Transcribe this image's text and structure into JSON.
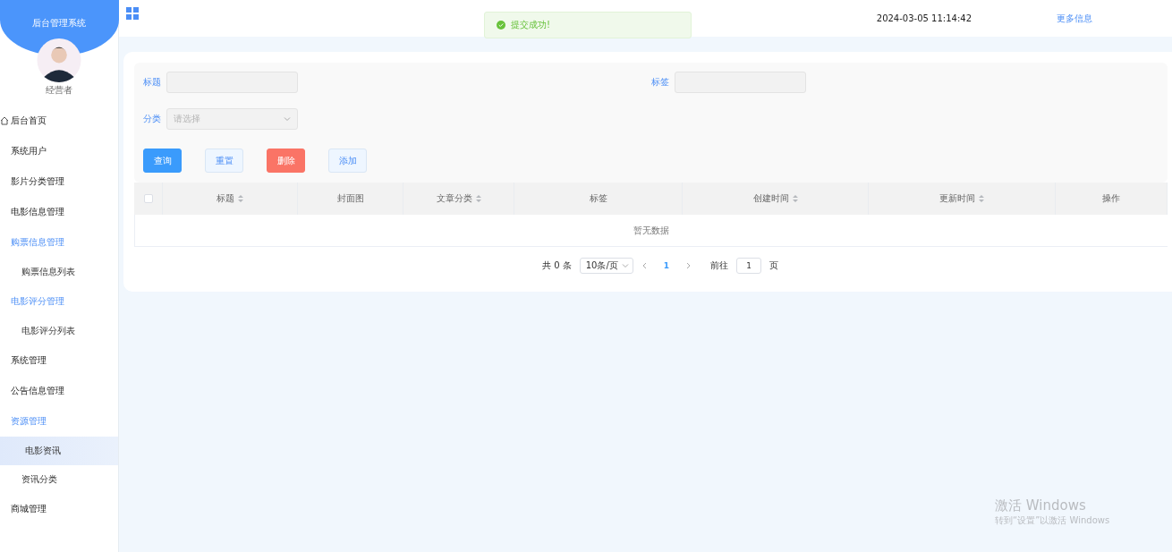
{
  "sidebar": {
    "title": "后台管理系统",
    "user_name": "经营者",
    "items": [
      {
        "label": "后台首页",
        "kind": "home",
        "expanded": false
      },
      {
        "label": "系统用户",
        "kind": "plain",
        "expanded": false
      },
      {
        "label": "影片分类管理",
        "kind": "plain",
        "expanded": false
      },
      {
        "label": "电影信息管理",
        "kind": "plain",
        "expanded": false
      },
      {
        "label": "购票信息管理",
        "kind": "plain",
        "expanded": true,
        "children": [
          {
            "label": "购票信息列表",
            "selected": false
          }
        ]
      },
      {
        "label": "电影评分管理",
        "kind": "plain",
        "expanded": true,
        "children": [
          {
            "label": "电影评分列表",
            "selected": false
          }
        ]
      },
      {
        "label": "系统管理",
        "kind": "plain",
        "expanded": false
      },
      {
        "label": "公告信息管理",
        "kind": "plain",
        "expanded": false
      },
      {
        "label": "资源管理",
        "kind": "plain",
        "expanded": true,
        "children": [
          {
            "label": "电影资讯",
            "selected": true
          },
          {
            "label": "资讯分类",
            "selected": false
          }
        ]
      },
      {
        "label": "商城管理",
        "kind": "plain",
        "expanded": false
      }
    ]
  },
  "header": {
    "datetime": "2024-03-05 11:14:42",
    "more_link": "更多信息"
  },
  "toast": {
    "kind": "success",
    "message": "提交成功!"
  },
  "filters": [
    {
      "label": "标题",
      "kind": "text"
    },
    {
      "label": "标签",
      "kind": "text"
    },
    {
      "label": "分类",
      "kind": "select",
      "placeholder": "请选择"
    }
  ],
  "buttons": [
    {
      "label": "查询",
      "kind": "primary"
    },
    {
      "label": "重置",
      "kind": "plain"
    },
    {
      "label": "删除",
      "kind": "danger"
    },
    {
      "label": "添加",
      "kind": "plain"
    }
  ],
  "table": {
    "columns": [
      {
        "label": "标题",
        "sortable": true
      },
      {
        "label": "封面图",
        "sortable": false
      },
      {
        "label": "文章分类",
        "sortable": true
      },
      {
        "label": "标签",
        "sortable": false
      },
      {
        "label": "创建时间",
        "sortable": true
      },
      {
        "label": "更新时间",
        "sortable": true
      },
      {
        "label": "操作",
        "sortable": false
      }
    ],
    "select_all": {
      "checked": false
    },
    "empty_text": "暂无数据"
  },
  "pagination": {
    "total": "共 0 条",
    "page_size": "10条/页",
    "pages": [
      {
        "label": "1",
        "selected": true
      }
    ],
    "goto_label": "前往",
    "goto_value": "1",
    "goto_suffix": "页"
  },
  "os_notice": {
    "title": "激活 Windows",
    "subtitle": "转到“设置”以激活 Windows"
  }
}
